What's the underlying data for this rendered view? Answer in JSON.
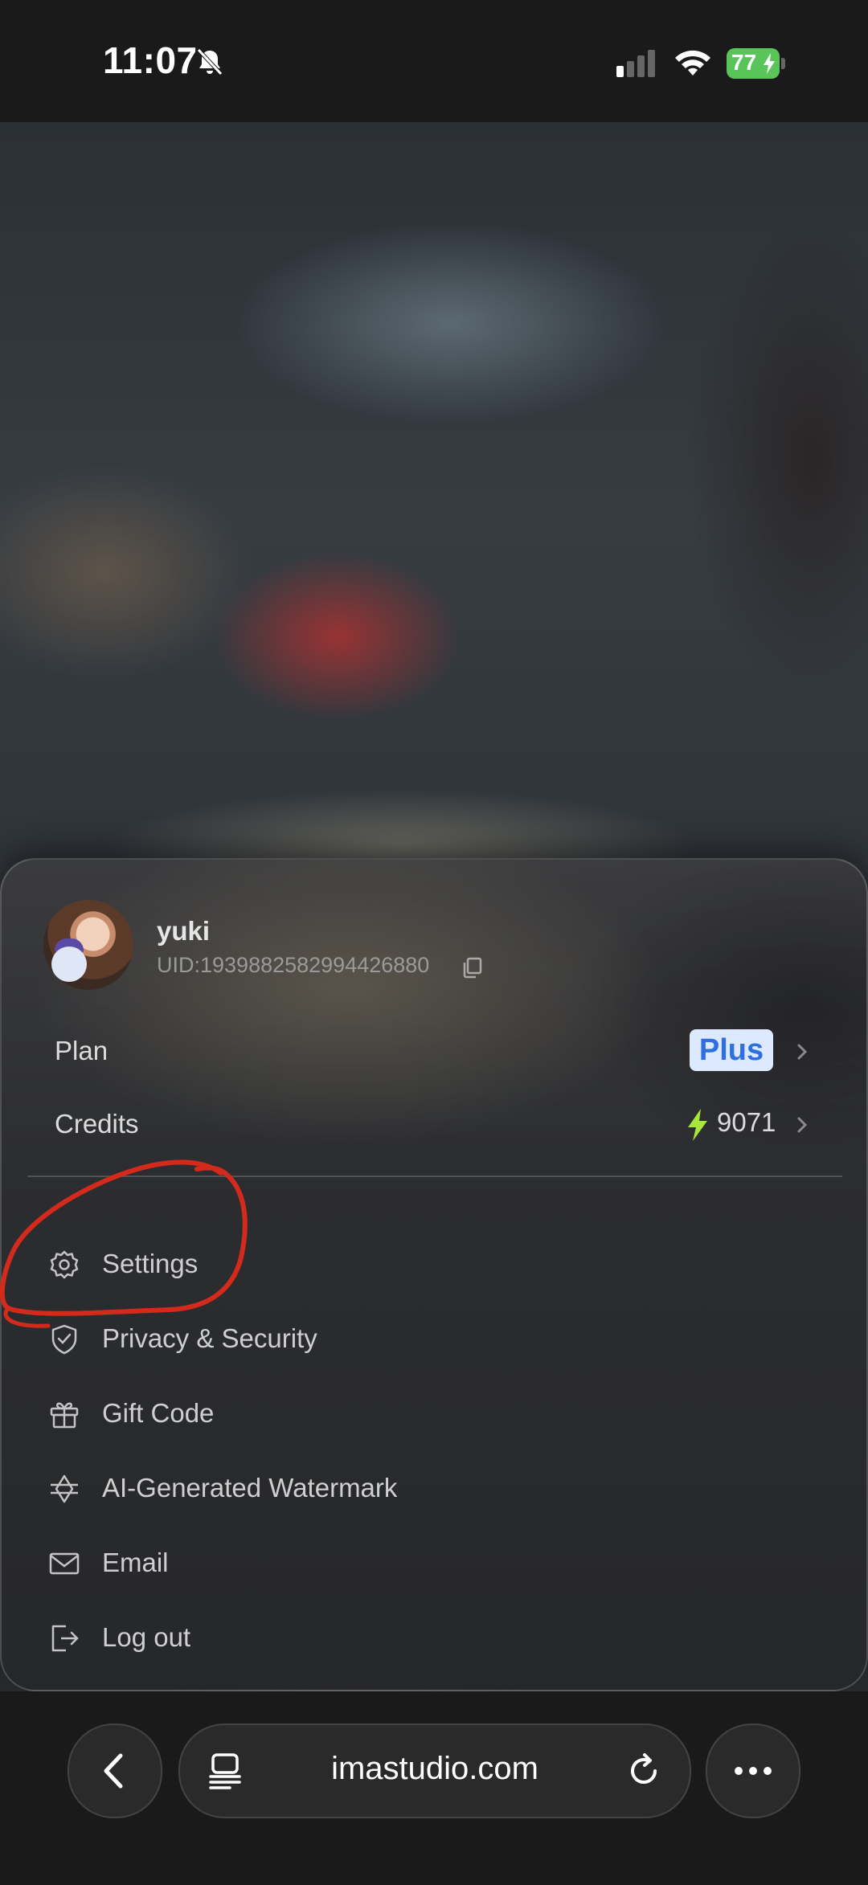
{
  "status_bar": {
    "time": "11:07",
    "battery": "77"
  },
  "profile": {
    "name": "yuki",
    "uid": "UID:1939882582994426880"
  },
  "plan": {
    "label": "Plan",
    "value": "Plus"
  },
  "credits": {
    "label": "Credits",
    "value": "9071"
  },
  "menu": [
    {
      "label": "Settings",
      "icon": "gear-icon"
    },
    {
      "label": "Privacy & Security",
      "icon": "shield-check-icon"
    },
    {
      "label": "Gift Code",
      "icon": "gift-icon"
    },
    {
      "label": "AI-Generated Watermark",
      "icon": "watermark-icon"
    },
    {
      "label": "Email",
      "icon": "mail-icon"
    },
    {
      "label": "Log out",
      "icon": "logout-icon"
    }
  ],
  "browser": {
    "url": "imastudio.com"
  },
  "colors": {
    "annotation": "#d42a1c",
    "plan_badge_bg": "#dce9ff",
    "plan_badge_text": "#2f6fe0",
    "bolt": "#a8e63a",
    "battery": "#58c45a"
  }
}
